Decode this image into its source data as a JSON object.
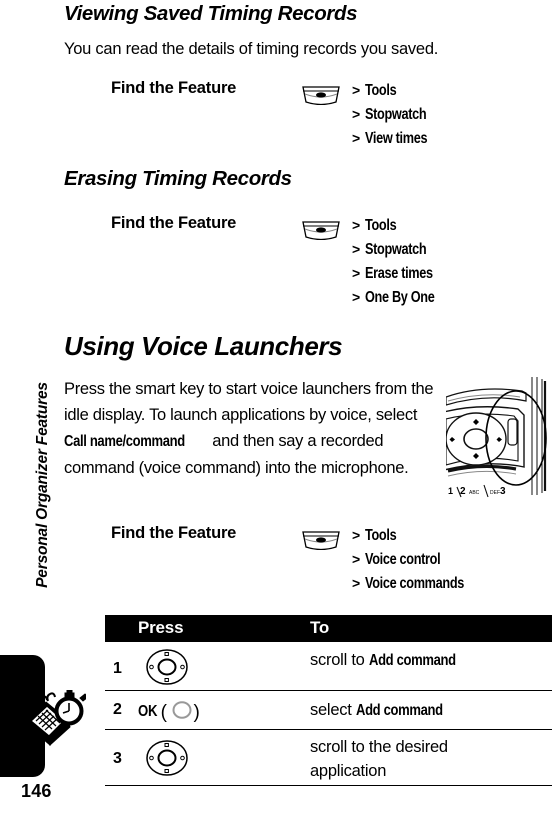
{
  "page": {
    "number": "146",
    "running_head": "Personal Organizer Features",
    "tab_icon": "organizer-stopwatch-icon"
  },
  "sections": [
    {
      "heading": "Viewing Saved Timing Records",
      "body": "You can read the details of timing records you saved.",
      "find_the_feature": {
        "label": "Find the Feature",
        "key_icon": "menu-key-icon",
        "path": [
          "Tools",
          "Stopwatch",
          "View times"
        ],
        "separator": ">"
      }
    },
    {
      "heading": "Erasing Timing Records",
      "find_the_feature": {
        "label": "Find the Feature",
        "key_icon": "menu-key-icon",
        "path": [
          "Tools",
          "Stopwatch",
          "Erase times",
          "One By One"
        ],
        "separator": ">"
      }
    },
    {
      "heading": "Using Voice Launchers",
      "paragraph": {
        "part1": "Press the smart key to start voice launchers from the idle display. To launch applications by voice, select ",
        "emphasis": "Call name/command",
        "part2": " and then say a recorded command (voice command) into the microphone."
      },
      "illustration": "phone-smart-key-illustration",
      "find_the_feature": {
        "label": "Find the Feature",
        "key_icon": "menu-key-icon",
        "path": [
          "Tools",
          "Voice control",
          "Voice commands"
        ],
        "separator": ">"
      }
    }
  ],
  "table": {
    "headers": {
      "press": "Press",
      "to": "To"
    },
    "rows": [
      {
        "num": "1",
        "key_icon": "nav-key-icon",
        "to_prefix": "scroll to ",
        "to_emphasis": "Add command",
        "to_suffix": ""
      },
      {
        "num": "2",
        "key_label": "OK",
        "key_icon": "select-key-icon",
        "paren_open": "(",
        "paren_close": ")",
        "to_prefix": "select ",
        "to_emphasis": "Add command",
        "to_suffix": ""
      },
      {
        "num": "3",
        "key_icon": "nav-key-icon",
        "to_line1": "scroll to the desired",
        "to_line2": "application"
      }
    ]
  },
  "colors": {
    "ink": "#000000",
    "paper": "#ffffff",
    "header_bar": "#000000",
    "header_text": "#ffffff"
  }
}
